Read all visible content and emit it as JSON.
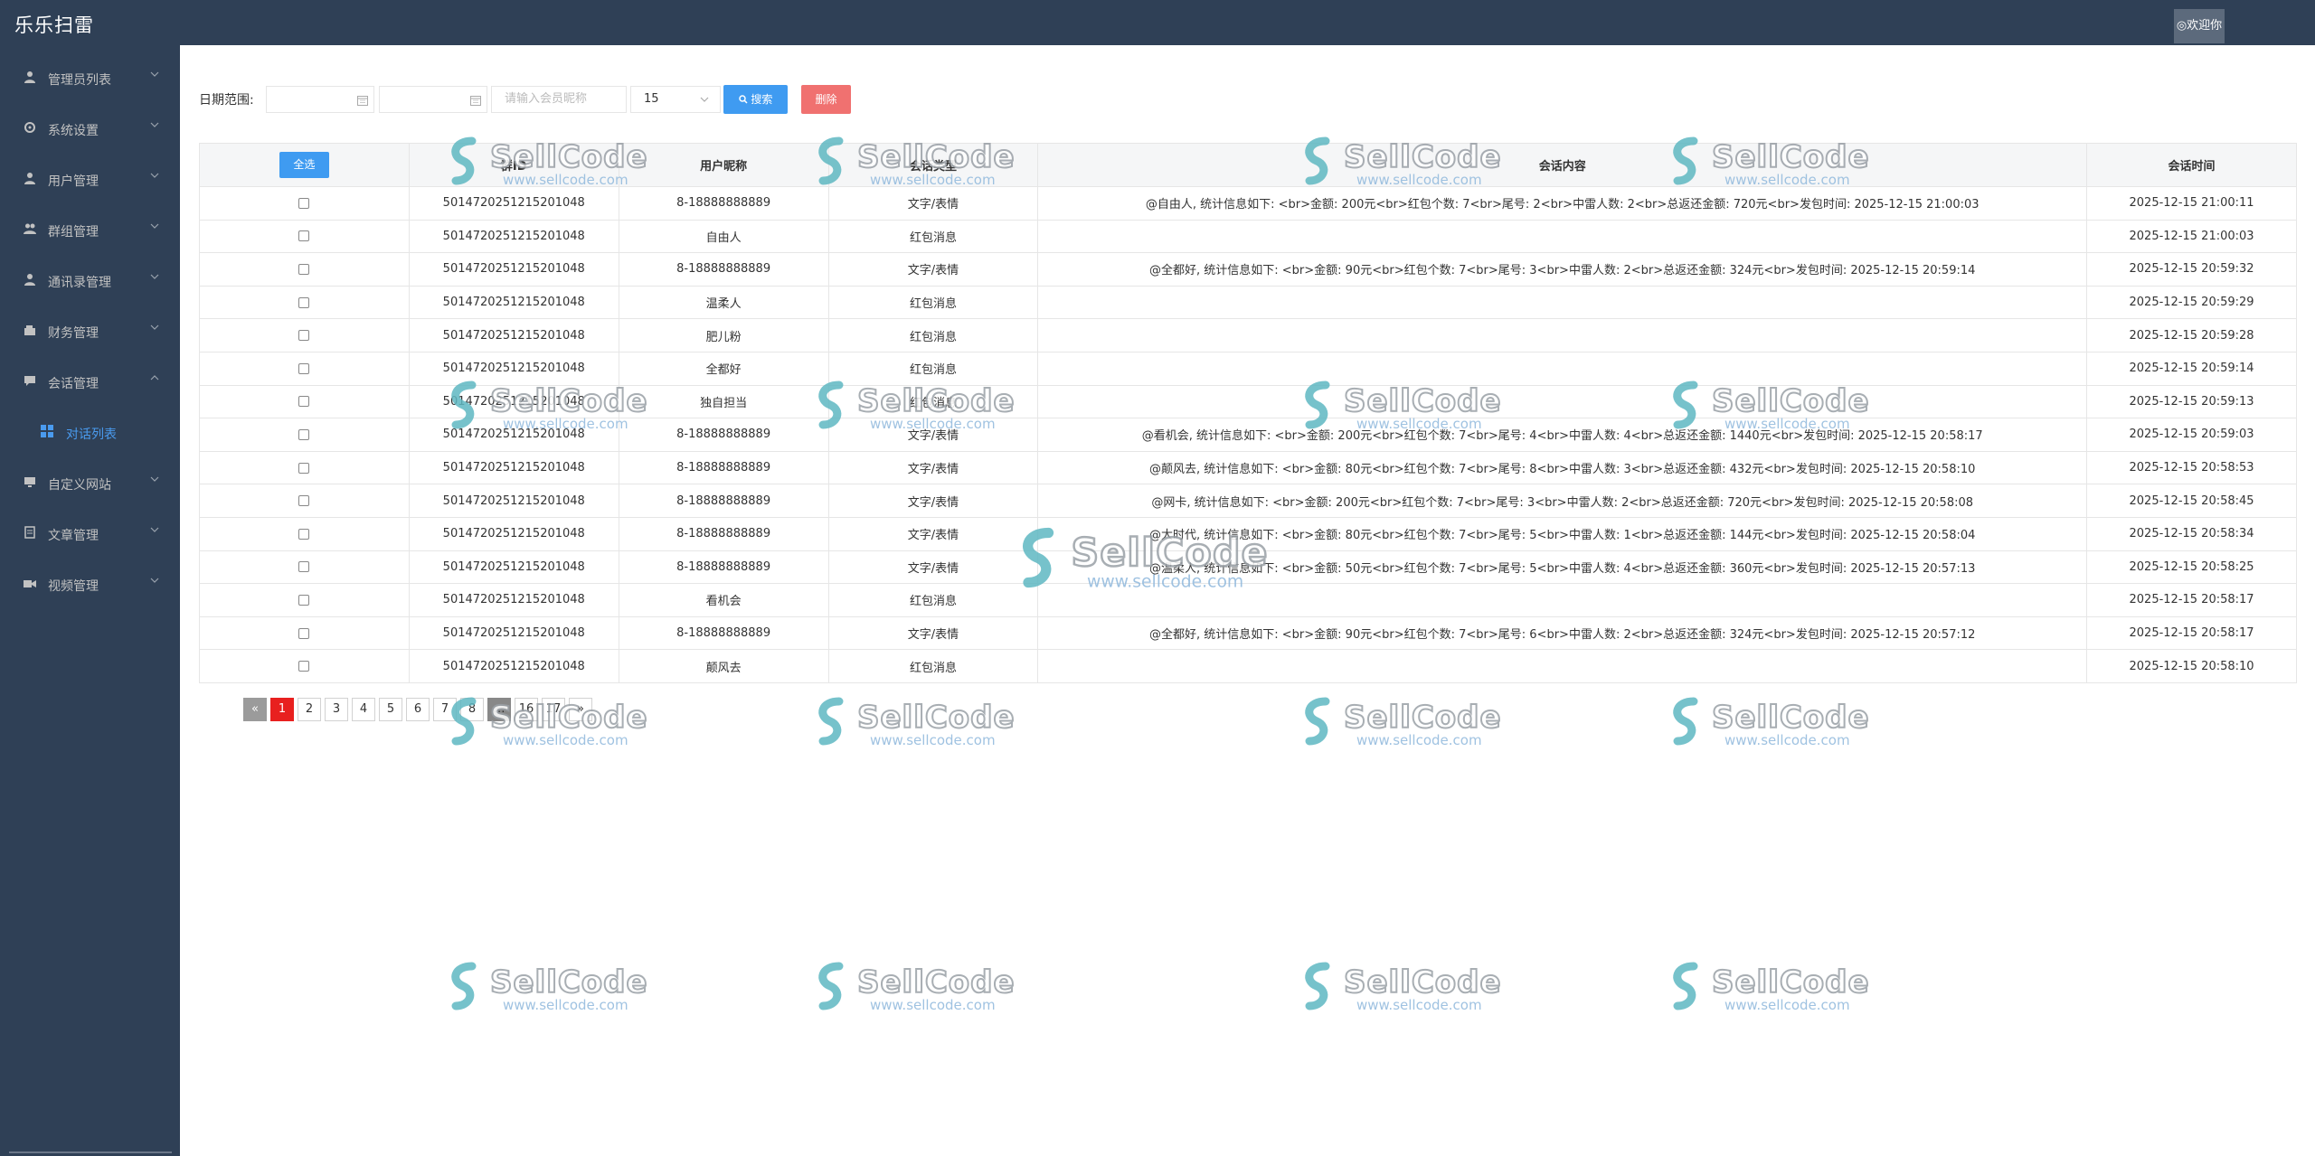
{
  "app": {
    "title": "乐乐扫雷",
    "welcome": "◎欢迎你"
  },
  "sidebar": {
    "items": [
      {
        "label": "管理员列表",
        "icon": "user-icon"
      },
      {
        "label": "系统设置",
        "icon": "gear-icon"
      },
      {
        "label": "用户管理",
        "icon": "user-icon"
      },
      {
        "label": "群组管理",
        "icon": "group-icon"
      },
      {
        "label": "通讯录管理",
        "icon": "user-icon"
      },
      {
        "label": "财务管理",
        "icon": "wallet-icon"
      },
      {
        "label": "会话管理",
        "icon": "chat-icon",
        "expanded": true
      },
      {
        "label": "对话列表",
        "icon": "grid-icon",
        "sub": true,
        "active": true
      },
      {
        "label": "自定义网站",
        "icon": "monitor-icon"
      },
      {
        "label": "文章管理",
        "icon": "document-icon"
      },
      {
        "label": "视频管理",
        "icon": "video-icon"
      }
    ]
  },
  "toolbar": {
    "date_label": "日期范围:",
    "search_placeholder": "请输入会员昵称",
    "page_size": "15",
    "search_label": "搜索",
    "delete_label": "删除"
  },
  "table": {
    "check_all": "全选",
    "columns": [
      "",
      "群ID",
      "用户昵称",
      "会话类型",
      "会话内容",
      "会话时间"
    ],
    "rows": [
      {
        "group": "5014720251215201048",
        "nick": "8-18888888889",
        "type": "文字/表情",
        "content": "@自由人, 统计信息如下: <br>金额: 200元<br>红包个数: 7<br>尾号: 2<br>中雷人数: 2<br>总返还金额: 720元<br>发包时间: 2025-12-15 21:00:03",
        "time": "2025-12-15 21:00:11"
      },
      {
        "group": "5014720251215201048",
        "nick": "自由人",
        "type": "红包消息",
        "content": "",
        "time": "2025-12-15 21:00:03"
      },
      {
        "group": "5014720251215201048",
        "nick": "8-18888888889",
        "type": "文字/表情",
        "content": "@全都好, 统计信息如下: <br>金额: 90元<br>红包个数: 7<br>尾号: 3<br>中雷人数: 2<br>总返还金额: 324元<br>发包时间: 2025-12-15 20:59:14",
        "time": "2025-12-15 20:59:32"
      },
      {
        "group": "5014720251215201048",
        "nick": "温柔人",
        "type": "红包消息",
        "content": "",
        "time": "2025-12-15 20:59:29"
      },
      {
        "group": "5014720251215201048",
        "nick": "肥儿粉",
        "type": "红包消息",
        "content": "",
        "time": "2025-12-15 20:59:28"
      },
      {
        "group": "5014720251215201048",
        "nick": "全都好",
        "type": "红包消息",
        "content": "",
        "time": "2025-12-15 20:59:14"
      },
      {
        "group": "5014720251215201048",
        "nick": "独自担当",
        "type": "红包消息",
        "content": "",
        "time": "2025-12-15 20:59:13"
      },
      {
        "group": "5014720251215201048",
        "nick": "8-18888888889",
        "type": "文字/表情",
        "content": "@看机会, 统计信息如下: <br>金额: 200元<br>红包个数: 7<br>尾号: 4<br>中雷人数: 4<br>总返还金额: 1440元<br>发包时间: 2025-12-15 20:58:17",
        "time": "2025-12-15 20:59:03"
      },
      {
        "group": "5014720251215201048",
        "nick": "8-18888888889",
        "type": "文字/表情",
        "content": "@颠风去, 统计信息如下: <br>金额: 80元<br>红包个数: 7<br>尾号: 8<br>中雷人数: 3<br>总返还金额: 432元<br>发包时间: 2025-12-15 20:58:10",
        "time": "2025-12-15 20:58:53"
      },
      {
        "group": "5014720251215201048",
        "nick": "8-18888888889",
        "type": "文字/表情",
        "content": "@网卡, 统计信息如下: <br>金额: 200元<br>红包个数: 7<br>尾号: 3<br>中雷人数: 2<br>总返还金额: 720元<br>发包时间: 2025-12-15 20:58:08",
        "time": "2025-12-15 20:58:45"
      },
      {
        "group": "5014720251215201048",
        "nick": "8-18888888889",
        "type": "文字/表情",
        "content": "@大时代, 统计信息如下: <br>金额: 80元<br>红包个数: 7<br>尾号: 5<br>中雷人数: 1<br>总返还金额: 144元<br>发包时间: 2025-12-15 20:58:04",
        "time": "2025-12-15 20:58:34"
      },
      {
        "group": "5014720251215201048",
        "nick": "8-18888888889",
        "type": "文字/表情",
        "content": "@温柔人, 统计信息如下: <br>金额: 50元<br>红包个数: 7<br>尾号: 5<br>中雷人数: 4<br>总返还金额: 360元<br>发包时间: 2025-12-15 20:57:13",
        "time": "2025-12-15 20:58:25"
      },
      {
        "group": "5014720251215201048",
        "nick": "看机会",
        "type": "红包消息",
        "content": "",
        "time": "2025-12-15 20:58:17"
      },
      {
        "group": "5014720251215201048",
        "nick": "8-18888888889",
        "type": "文字/表情",
        "content": "@全都好, 统计信息如下: <br>金额: 90元<br>红包个数: 7<br>尾号: 6<br>中雷人数: 2<br>总返还金额: 324元<br>发包时间: 2025-12-15 20:57:12",
        "time": "2025-12-15 20:58:17"
      },
      {
        "group": "5014720251215201048",
        "nick": "颠风去",
        "type": "红包消息",
        "content": "",
        "time": "2025-12-15 20:58:10"
      }
    ]
  },
  "pagination": {
    "prev": "«",
    "pages": [
      "1",
      "2",
      "3",
      "4",
      "5",
      "6",
      "7",
      "8",
      "…",
      "16",
      "17"
    ],
    "next": "»",
    "current": "1"
  },
  "watermark": {
    "brand": "SellCode",
    "url": "www.sellcode.com"
  },
  "colors": {
    "sidebar": "#2f4056",
    "primary": "#3f9bf1",
    "danger": "#f07170",
    "page_active": "#e8201f",
    "submenu_active": "#4a9bef"
  }
}
